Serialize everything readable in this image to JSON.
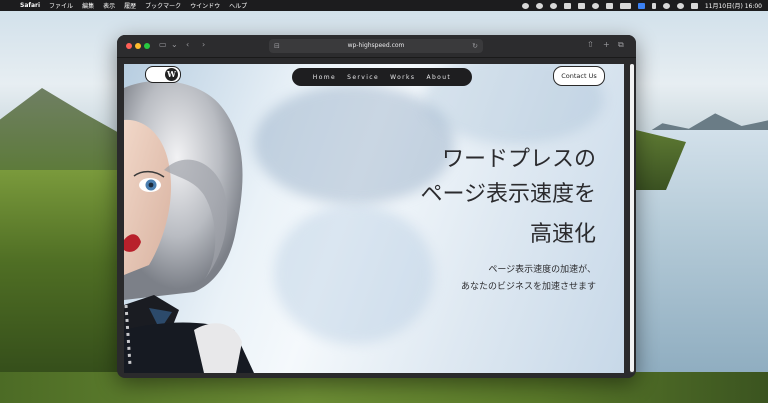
{
  "menubar": {
    "app_name": "Safari",
    "menus": [
      "ファイル",
      "編集",
      "表示",
      "履歴",
      "ブックマーク",
      "ウインドウ",
      "ヘルプ"
    ],
    "clock": "11月10日(月) 16:00",
    "status_icons": [
      "dropbox-icon",
      "spotify-icon",
      "clock-icon",
      "cloud-icon",
      "network-icon",
      "record-icon",
      "volume-icon",
      "battery-icon",
      "input-source-icon",
      "bluetooth-icon",
      "wifi-icon",
      "search-icon",
      "control-center-icon"
    ]
  },
  "browser": {
    "url": "wp-highspeed.com"
  },
  "site": {
    "nav": [
      "Home",
      "Service",
      "Works",
      "About"
    ],
    "contact_label": "Contact Us",
    "headline": [
      "ワードプレスの",
      "ページ表示速度を",
      "高速化"
    ],
    "subtext": [
      "ページ表示速度の加速が、",
      "あなたのビジネスを加速させます"
    ]
  },
  "colors": {
    "menubar_bg": "#1c1c1e",
    "window_bg": "#2a2a2c",
    "nav_pill_bg": "#1e1e20",
    "headline_text": "#2b2b2e"
  }
}
